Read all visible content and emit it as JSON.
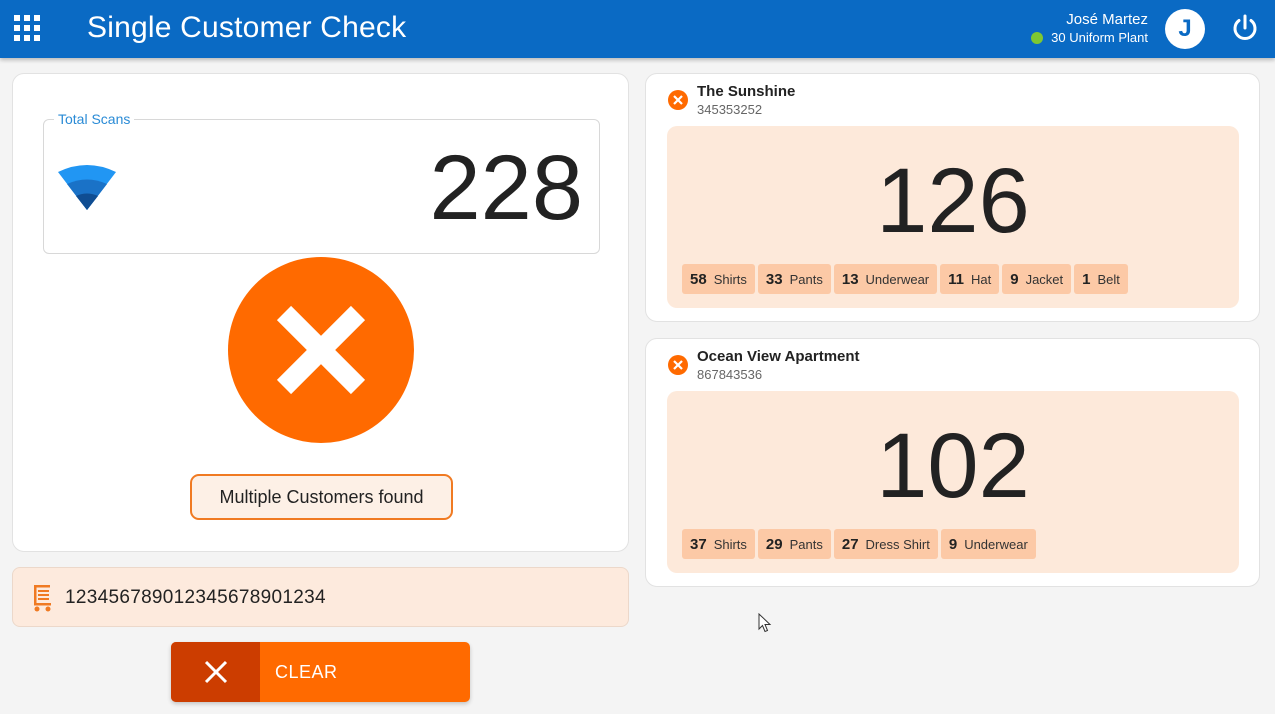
{
  "header": {
    "title": "Single Customer Check",
    "user_name": "José Martez",
    "plant": "30 Uniform Plant",
    "avatar_initial": "J",
    "status_color": "#7ec832",
    "brand_color": "#0a6ac4",
    "icons": {
      "apps": "grid-apps-icon",
      "power": "power-icon"
    }
  },
  "scans": {
    "label": "Total Scans",
    "value": "228",
    "icon": "rfid-signal-icon"
  },
  "status": {
    "message": "Multiple Customers found",
    "icon": "close-circle-icon",
    "accent_color": "#ff6a00"
  },
  "barcode": {
    "value": "1234567890123456789​01234",
    "icon": "cart-icon"
  },
  "clear": {
    "label": "CLEAR",
    "icon": "close-icon"
  },
  "customers": [
    {
      "name": "The Sunshine",
      "id": "345353252",
      "count": "126",
      "items": [
        {
          "qty": "58",
          "label": "Shirts"
        },
        {
          "qty": "33",
          "label": "Pants"
        },
        {
          "qty": "13",
          "label": "Underwear"
        },
        {
          "qty": "11",
          "label": "Hat"
        },
        {
          "qty": "9",
          "label": "Jacket"
        },
        {
          "qty": "1",
          "label": "Belt"
        }
      ]
    },
    {
      "name": "Ocean View Apartment",
      "id": "867843536",
      "count": "102",
      "items": [
        {
          "qty": "37",
          "label": "Shirts"
        },
        {
          "qty": "29",
          "label": "Pants"
        },
        {
          "qty": "27",
          "label": "Dress Shirt"
        },
        {
          "qty": "9",
          "label": "Underwear"
        }
      ]
    }
  ]
}
